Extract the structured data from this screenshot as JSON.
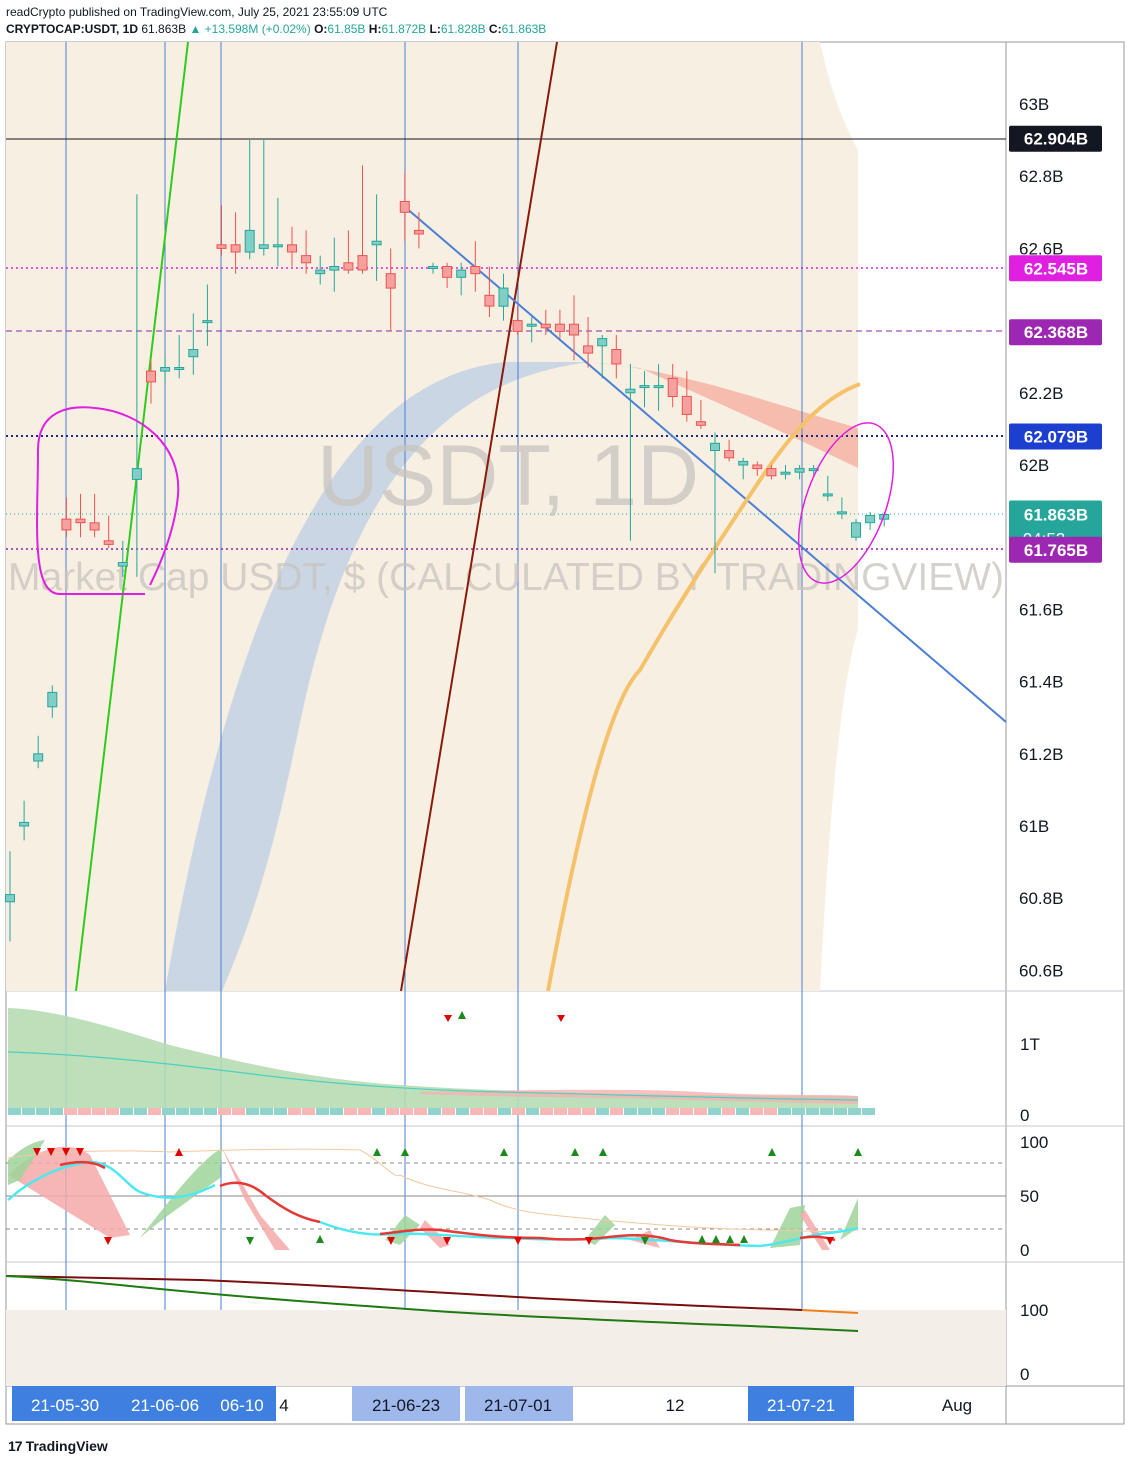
{
  "header": {
    "published": "readCrypto published on TradingView.com, July 25, 2021 23:55:09 UTC",
    "symbol": "CRYPTOCAP:USDT, 1D",
    "last": "61.863B",
    "change": "▲ +13.598M (+0.02%)",
    "o_label": "O:",
    "o_value": "61.85B",
    "h_label": "H:",
    "h_value": "61.872B",
    "l_label": "L:",
    "l_value": "61.828B",
    "c_label": "C:",
    "c_value": "61.863B"
  },
  "watermark": {
    "ticker": "USDT, 1D",
    "description": "Market Cap USDT, $ (CALCULATED BY TRADINGVIEW)"
  },
  "footer": {
    "logo_text": "TradingView"
  },
  "colors": {
    "up": "#26a69a",
    "down": "#ef5350",
    "magenta": "#e020e0",
    "purple": "#9c27b0",
    "blue_line": "#4a7fd4",
    "green_line": "#2ecc1a",
    "darkred_line": "#8b1a0a",
    "orange_curve": "#f5c26b",
    "band": "#f7efe2"
  },
  "chart_data": [
    {
      "type": "candlestick",
      "title": "CRYPTOCAP:USDT, 1D",
      "ylabel": "",
      "y_unit": "B",
      "ylim": [
        60.5,
        63.25
      ],
      "y_ticks": [
        "60.6B",
        "60.8B",
        "61B",
        "61.2B",
        "61.4B",
        "61.6B",
        "62B",
        "62.2B",
        "62.6B",
        "62.8B",
        "63B"
      ],
      "x_labels": [
        "21-05-30",
        "21-06-06",
        "06-10",
        "4",
        "21-06-23",
        "21-07-01",
        "12",
        "21-07-21",
        "Aug"
      ],
      "highlighted_x_labels": [
        "21-05-30",
        "21-06-06",
        "06-10",
        "21-06-23",
        "21-07-01",
        "21-07-21"
      ],
      "price_labels": [
        {
          "text": "62.904B",
          "value": 62.904,
          "style": "black"
        },
        {
          "text": "62.545B",
          "value": 62.545,
          "style": "magenta"
        },
        {
          "text": "62.368B",
          "value": 62.368,
          "style": "purple"
        },
        {
          "text": "62.079B",
          "value": 62.079,
          "style": "blue"
        },
        {
          "text": "61.863B",
          "value": 61.863,
          "style": "last",
          "countdown": "04:52"
        },
        {
          "text": "61.765B",
          "value": 61.765,
          "style": "purple"
        }
      ],
      "candles": [
        {
          "o": 60.79,
          "h": 60.93,
          "l": 60.68,
          "c": 60.81
        },
        {
          "o": 61.0,
          "h": 61.07,
          "l": 60.96,
          "c": 61.01
        },
        {
          "o": 61.18,
          "h": 61.25,
          "l": 61.16,
          "c": 61.2
        },
        {
          "o": 61.33,
          "h": 61.39,
          "l": 61.3,
          "c": 61.37
        },
        {
          "o": 61.85,
          "h": 61.91,
          "l": 61.8,
          "c": 61.82
        },
        {
          "o": 61.85,
          "h": 61.92,
          "l": 61.8,
          "c": 61.84
        },
        {
          "o": 61.84,
          "h": 61.92,
          "l": 61.8,
          "c": 61.82
        },
        {
          "o": 61.79,
          "h": 61.86,
          "l": 61.77,
          "c": 61.78
        },
        {
          "o": 61.72,
          "h": 61.79,
          "l": 61.69,
          "c": 61.73
        },
        {
          "o": 61.96,
          "h": 62.75,
          "l": 61.69,
          "c": 61.99
        },
        {
          "o": 62.26,
          "h": 62.29,
          "l": 62.17,
          "c": 62.23
        },
        {
          "o": 62.26,
          "h": 62.3,
          "l": 62.23,
          "c": 62.27
        },
        {
          "o": 62.27,
          "h": 62.36,
          "l": 62.24,
          "c": 62.27
        },
        {
          "o": 62.3,
          "h": 62.42,
          "l": 62.25,
          "c": 62.32
        },
        {
          "o": 62.4,
          "h": 62.5,
          "l": 62.33,
          "c": 62.4
        },
        {
          "o": 62.61,
          "h": 62.72,
          "l": 62.58,
          "c": 62.6
        },
        {
          "o": 62.61,
          "h": 62.7,
          "l": 62.53,
          "c": 62.59
        },
        {
          "o": 62.59,
          "h": 62.9,
          "l": 62.57,
          "c": 62.65
        },
        {
          "o": 62.6,
          "h": 62.9,
          "l": 62.58,
          "c": 62.61
        },
        {
          "o": 62.61,
          "h": 62.74,
          "l": 62.55,
          "c": 62.61
        },
        {
          "o": 62.61,
          "h": 62.66,
          "l": 62.55,
          "c": 62.59
        },
        {
          "o": 62.58,
          "h": 62.65,
          "l": 62.53,
          "c": 62.56
        },
        {
          "o": 62.53,
          "h": 62.58,
          "l": 62.5,
          "c": 62.54
        },
        {
          "o": 62.54,
          "h": 62.63,
          "l": 62.48,
          "c": 62.55
        },
        {
          "o": 62.56,
          "h": 62.65,
          "l": 62.53,
          "c": 62.54
        },
        {
          "o": 62.58,
          "h": 62.83,
          "l": 62.53,
          "c": 62.54
        },
        {
          "o": 62.61,
          "h": 62.75,
          "l": 62.51,
          "c": 62.62
        },
        {
          "o": 62.53,
          "h": 62.6,
          "l": 62.37,
          "c": 62.49
        },
        {
          "o": 62.73,
          "h": 62.81,
          "l": 62.62,
          "c": 62.7
        },
        {
          "o": 62.65,
          "h": 62.7,
          "l": 62.6,
          "c": 62.64
        },
        {
          "o": 62.55,
          "h": 62.56,
          "l": 62.53,
          "c": 62.55
        },
        {
          "o": 62.55,
          "h": 62.56,
          "l": 62.49,
          "c": 62.52
        },
        {
          "o": 62.52,
          "h": 62.56,
          "l": 62.47,
          "c": 62.54
        },
        {
          "o": 62.55,
          "h": 62.62,
          "l": 62.48,
          "c": 62.53
        },
        {
          "o": 62.47,
          "h": 62.55,
          "l": 62.41,
          "c": 62.44
        },
        {
          "o": 62.44,
          "h": 62.53,
          "l": 62.4,
          "c": 62.49
        },
        {
          "o": 62.4,
          "h": 62.44,
          "l": 62.36,
          "c": 62.37
        },
        {
          "o": 62.39,
          "h": 62.41,
          "l": 62.34,
          "c": 62.39
        },
        {
          "o": 62.39,
          "h": 62.43,
          "l": 62.36,
          "c": 62.38
        },
        {
          "o": 62.39,
          "h": 62.43,
          "l": 62.35,
          "c": 62.37
        },
        {
          "o": 62.39,
          "h": 62.47,
          "l": 62.29,
          "c": 62.36
        },
        {
          "o": 62.33,
          "h": 62.41,
          "l": 62.27,
          "c": 62.31
        },
        {
          "o": 62.33,
          "h": 62.36,
          "l": 62.24,
          "c": 62.35
        },
        {
          "o": 62.32,
          "h": 62.36,
          "l": 62.24,
          "c": 62.28
        },
        {
          "o": 62.2,
          "h": 62.28,
          "l": 61.79,
          "c": 62.21
        },
        {
          "o": 62.22,
          "h": 62.26,
          "l": 62.16,
          "c": 62.22
        },
        {
          "o": 62.22,
          "h": 62.28,
          "l": 62.15,
          "c": 62.22
        },
        {
          "o": 62.24,
          "h": 62.28,
          "l": 62.16,
          "c": 62.19
        },
        {
          "o": 62.19,
          "h": 62.26,
          "l": 62.12,
          "c": 62.14
        },
        {
          "o": 62.12,
          "h": 62.18,
          "l": 62.1,
          "c": 62.11
        },
        {
          "o": 62.04,
          "h": 62.09,
          "l": 61.7,
          "c": 62.06
        },
        {
          "o": 62.04,
          "h": 62.07,
          "l": 62.01,
          "c": 62.02
        },
        {
          "o": 62.0,
          "h": 62.02,
          "l": 61.96,
          "c": 62.01
        },
        {
          "o": 62.0,
          "h": 62.01,
          "l": 61.97,
          "c": 61.99
        },
        {
          "o": 61.99,
          "h": 62.0,
          "l": 61.96,
          "c": 61.97
        },
        {
          "o": 61.98,
          "h": 62.0,
          "l": 61.96,
          "c": 61.98
        },
        {
          "o": 61.98,
          "h": 62.0,
          "l": 61.96,
          "c": 61.99
        },
        {
          "o": 61.99,
          "h": 62.0,
          "l": 61.97,
          "c": 61.99
        },
        {
          "o": 61.92,
          "h": 61.97,
          "l": 61.9,
          "c": 61.92
        },
        {
          "o": 61.87,
          "h": 61.91,
          "l": 61.85,
          "c": 61.87
        },
        {
          "o": 61.8,
          "h": 61.85,
          "l": 61.79,
          "c": 61.84
        },
        {
          "o": 61.84,
          "h": 61.87,
          "l": 61.82,
          "c": 61.86
        },
        {
          "o": 61.85,
          "h": 61.87,
          "l": 61.83,
          "c": 61.863
        }
      ],
      "lower_panels": [
        {
          "name": "volume-panel",
          "y_ticks": [
            "1T",
            "0"
          ]
        },
        {
          "name": "oscillator-panel",
          "y_ticks": [
            "100",
            "50",
            "0"
          ]
        },
        {
          "name": "trend-panel",
          "y_ticks": [
            "100",
            "0"
          ]
        }
      ]
    }
  ]
}
